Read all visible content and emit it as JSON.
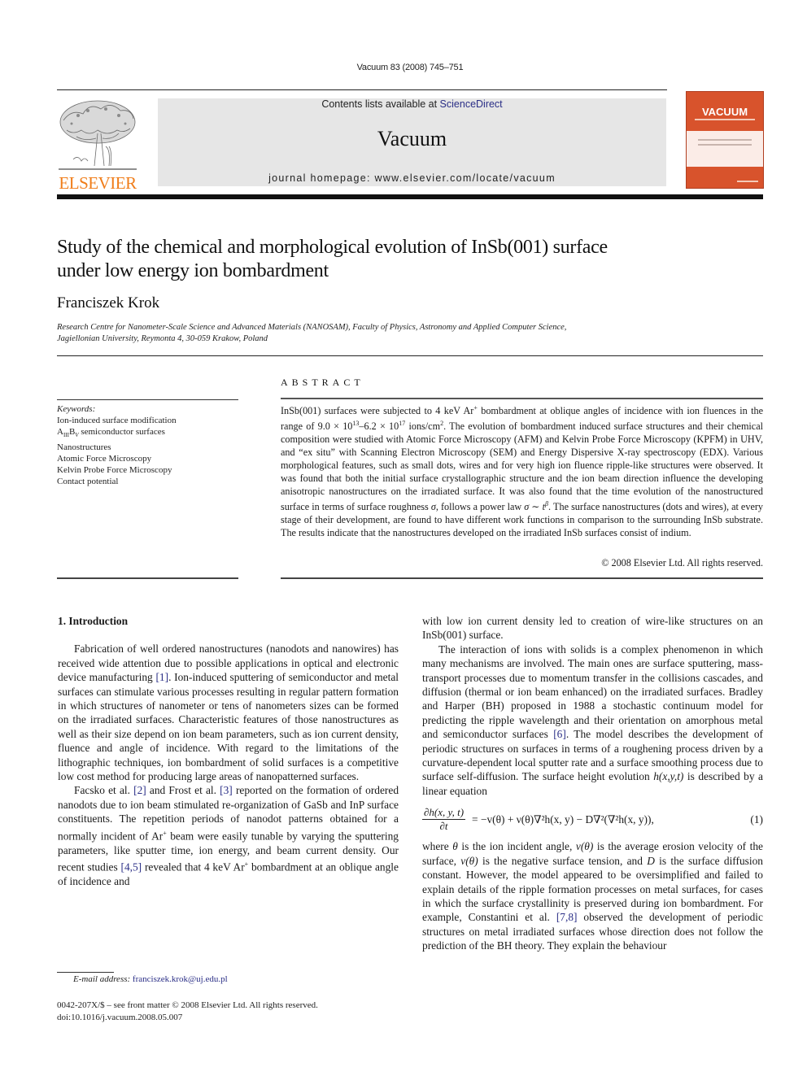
{
  "header": {
    "journal_ref": "Vacuum 83 (2008) 745–751",
    "contents_prefix": "Contents lists available at ",
    "contents_link": "ScienceDirect",
    "journal_name": "Vacuum",
    "homepage": "journal homepage: www.elsevier.com/locate/vacuum",
    "publisher_logo_text": "ELSEVIER",
    "cover_title": "VACUUM",
    "colors": {
      "publisher_orange": "#f07d1a",
      "cover_orange": "#d8532c",
      "masthead_gray": "#e6e6e6",
      "link_blue": "#2a2e86"
    }
  },
  "article": {
    "title_line1": "Study of the chemical and morphological evolution of InSb(001) surface",
    "title_line2": "under low energy ion bombardment",
    "author": "Franciszek Krok",
    "affiliation_line1": "Research Centre for Nanometer-Scale Science and Advanced Materials (NANOSAM), Faculty of Physics, Astronomy and Applied Computer Science,",
    "affiliation_line2": "Jagiellonian University, Reymonta 4, 30-059 Krakow, Poland"
  },
  "keywords": {
    "label": "Keywords:",
    "items": [
      "Ion-induced surface modification",
      "A_III B_V semiconductor surfaces",
      "Nanostructures",
      "Atomic Force Microscopy",
      "Kelvin Probe Force Microscopy",
      "Contact potential"
    ],
    "item2_parts": {
      "a": "A",
      "sub1": "III",
      "b": "B",
      "sub2": "V",
      "rest": " semiconductor surfaces"
    }
  },
  "abstract": {
    "heading": "ABSTRACT",
    "p1": "InSb(001) surfaces were subjected to 4 keV Ar",
    "p1_sup": "+",
    "p2": " bombardment at oblique angles of incidence with ion fluences in the range of 9.0 × 10",
    "p2_sup": "13",
    "p3": "–6.2 × 10",
    "p3_sup": "17",
    "p4": " ions/cm",
    "p4_sup": "2",
    "p5": ". The evolution of bombardment induced surface structures and their chemical composition were studied with Atomic Force Microscopy (AFM) and Kelvin Probe Force Microscopy (KPFM) in UHV, and “ex situ” with Scanning Electron Microscopy (SEM) and Energy Dispersive X-ray spectroscopy (EDX). Various morphological features, such as small dots, wires and for very high ion fluence ripple-like structures were observed. It was found that both the initial surface crystallographic structure and the ion beam direction influence the developing anisotropic nanostructures on the irradiated surface. It was also found that the time evolution of the nanostructured surface in terms of surface roughness ",
    "sigma": "σ",
    "p6": ", follows a power law ",
    "power_law": "σ ∼ t",
    "power_law_sup": "β",
    "p7": ". The surface nanostructures (dots and wires), at every stage of their development, are found to have different work functions in comparison to the surrounding InSb substrate. The results indicate that the nanostructures developed on the irradiated InSb surfaces consist of indium.",
    "copyright": "© 2008 Elsevier Ltd. All rights reserved."
  },
  "body": {
    "section1_heading": "1.  Introduction",
    "left": {
      "para1_a": "Fabrication of well ordered nanostructures (nanodots and nanowires) has received wide attention due to possible applications in optical and electronic device manufacturing ",
      "para1_ref1": "[1]",
      "para1_b": ". Ion-induced sputtering of semiconductor and metal surfaces can stimulate various processes resulting in regular pattern formation in which structures of nanometer or tens of nanometers sizes can be formed on the irradiated surfaces. Characteristic features of those nanostructures as well as their size depend on ion beam parameters, such as ion current density, fluence and angle of incidence. With regard to the limitations of the lithographic techniques, ion bombardment of solid surfaces is a competitive low cost method for producing large areas of nanopatterned surfaces.",
      "para2_a": "Facsko et al. ",
      "para2_ref2": "[2]",
      "para2_b": " and Frost et al. ",
      "para2_ref3": "[3]",
      "para2_c": " reported on the formation of ordered nanodots due to ion beam stimulated re-organization of GaSb and InP surface constituents. The repetition periods of nanodot patterns obtained for a normally incident of Ar",
      "para2_sup1": "+",
      "para2_d": " beam were easily tunable by varying the sputtering parameters, like sputter time, ion energy, and beam current density. Our recent studies ",
      "para2_ref45": "[4,5]",
      "para2_e": " revealed that 4 keV Ar",
      "para2_sup2": "+",
      "para2_f": " bombardment at an oblique angle of incidence and"
    },
    "right": {
      "para0": "with low ion current density led to creation of wire-like structures on an InSb(001) surface.",
      "para3_a": "The interaction of ions with solids is a complex phenomenon in which many mechanisms are involved. The main ones are surface sputtering, mass-transport processes due to momentum transfer in the collisions cascades, and diffusion (thermal or ion beam enhanced) on the irradiated surfaces. Bradley and Harper (BH) proposed in 1988 a stochastic continuum model for predicting the ripple wavelength and their orientation on amorphous metal and semiconductor surfaces ",
      "para3_ref6": "[6]",
      "para3_b": ". The model describes the development of periodic structures on surfaces in terms of a roughening process driven by a curvature-dependent local sputter rate and a surface smoothing process due to surface self-diffusion. The surface height evolution ",
      "para3_h": "h(x,y,t)",
      "para3_c": " is described by a linear equation",
      "equation": {
        "numerator": "∂h(x, y, t)",
        "denominator": "∂t",
        "rhs": "= −v(θ) + ν(θ)∇²h(x, y) − D∇²(∇²h(x, y)),",
        "number": "(1)"
      },
      "para4_a": "where ",
      "para4_theta": "θ",
      "para4_b": " is the ion incident angle, ",
      "para4_v": "v(θ)",
      "para4_c": " is the average erosion velocity of the surface, ",
      "para4_nu": "ν(θ)",
      "para4_d": " is the negative surface tension, and ",
      "para4_D": "D",
      "para4_e": " is the surface diffusion constant. However, the model appeared to be oversimplified and failed to explain details of the ripple formation processes on metal surfaces, for cases in which the surface crystallinity is preserved during ion bombardment. For example, Constantini et al. ",
      "para4_ref78": "[7,8]",
      "para4_f": " observed the development of periodic structures on metal irradiated surfaces whose direction does not follow the prediction of the BH theory. They explain the behaviour"
    }
  },
  "footer": {
    "email_label": "E-mail address:",
    "email": "franciszek.krok@uj.edu.pl",
    "front_matter": "0042-207X/$ – see front matter © 2008 Elsevier Ltd. All rights reserved.",
    "doi": "doi:10.1016/j.vacuum.2008.05.007"
  }
}
